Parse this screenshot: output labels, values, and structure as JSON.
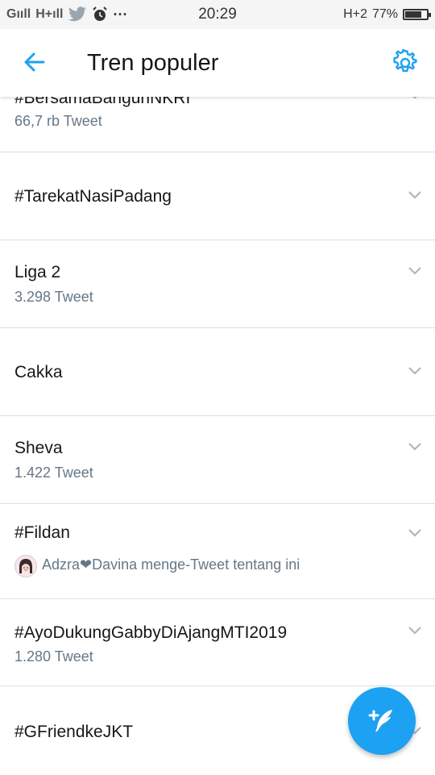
{
  "status_bar": {
    "signal_1": "Gııll",
    "signal_2": "H+ıll",
    "time": "20:29",
    "network": "H+2",
    "battery": "77%",
    "battery_level": 0.77
  },
  "header": {
    "title": "Tren populer",
    "back_icon": "arrow-left-icon",
    "settings_icon": "gear-icon"
  },
  "trends": [
    {
      "name": "#BersamaBangunNKRI",
      "sub": "66,7 rb Tweet"
    },
    {
      "name": "#TarekatNasiPadang",
      "sub": ""
    },
    {
      "name": "Liga 2",
      "sub": "3.298 Tweet"
    },
    {
      "name": "Cakka",
      "sub": ""
    },
    {
      "name": "Sheva",
      "sub": "1.422 Tweet"
    },
    {
      "name": "#Fildan",
      "sub": "Adzra❤Davina menge-Tweet tentang ini"
    },
    {
      "name": "#AyoDukungGabbyDiAjangMTI2019",
      "sub": "1.280 Tweet"
    },
    {
      "name": "#GFriendkeJKT",
      "sub": ""
    }
  ],
  "fab": {
    "icon": "compose-tweet-icon"
  },
  "colors": {
    "accent": "#1da1f2",
    "text": "#14171a",
    "secondary": "#657786",
    "divider": "#d8dfe4"
  }
}
